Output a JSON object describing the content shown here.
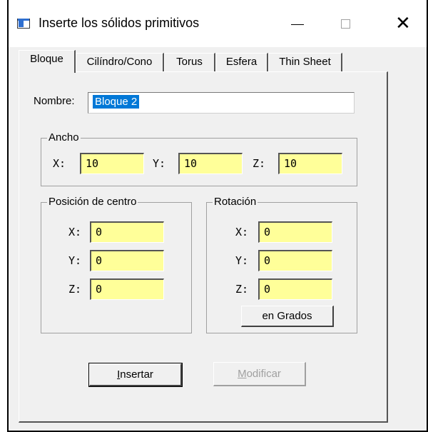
{
  "window": {
    "title": "Inserte los sólidos primitivos",
    "close_glyph": "✕"
  },
  "tabs": [
    {
      "label": "Bloque"
    },
    {
      "label": "Cilíndro/Cono"
    },
    {
      "label": "Torus"
    },
    {
      "label": "Esfera"
    },
    {
      "label": "Thin Sheet"
    }
  ],
  "form": {
    "name_label": "Nombre:",
    "name_value": "Bloque 2",
    "ancho": {
      "title": "Ancho",
      "x_label": "X:",
      "x_value": "10",
      "y_label": "Y:",
      "y_value": "10",
      "z_label": "Z:",
      "z_value": "10"
    },
    "posicion": {
      "title": "Posición de centro",
      "x_label": "X:",
      "x_value": "0",
      "y_label": "Y:",
      "y_value": "0",
      "z_label": "Z:",
      "z_value": "0"
    },
    "rotacion": {
      "title": "Rotación",
      "x_label": "X:",
      "x_value": "0",
      "y_label": "Y:",
      "y_value": "0",
      "z_label": "Z:",
      "z_value": "0",
      "grados_button": "en Grados"
    }
  },
  "buttons": {
    "insert_first": "I",
    "insert_rest": "nsertar",
    "modify_first": "M",
    "modify_rest": "odificar"
  },
  "colors": {
    "input_yellow": "#ffff99",
    "selection": "#0078d7",
    "dialog_bg": "#f0f0f0"
  }
}
